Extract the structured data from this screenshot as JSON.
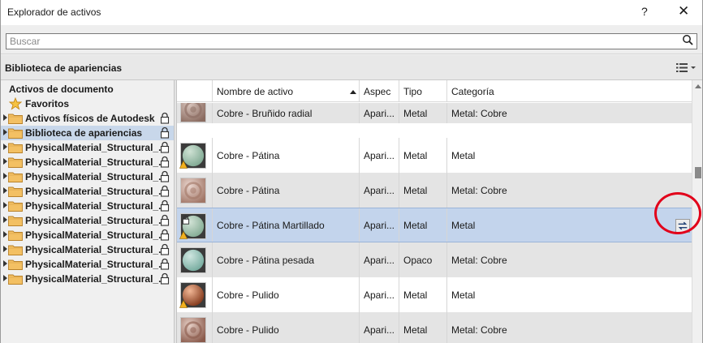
{
  "window": {
    "title": "Explorador de activos",
    "help_label": "?",
    "close_label": "✕"
  },
  "search": {
    "placeholder": "Buscar",
    "value": ""
  },
  "library_bar": {
    "title": "Biblioteca de apariencias"
  },
  "tree": {
    "header": "Activos de documento",
    "items": [
      {
        "label": "Favoritos",
        "icon": "star-icon",
        "locked": false
      },
      {
        "label": "Activos físicos de Autodesk",
        "icon": "folder-icon",
        "locked": true
      },
      {
        "label": "Biblioteca de apariencias",
        "icon": "folder-icon",
        "locked": true,
        "selected": true
      },
      {
        "label": "PhysicalMaterial_Structural_...",
        "icon": "folder-icon",
        "locked": true
      },
      {
        "label": "PhysicalMaterial_Structural_...",
        "icon": "folder-icon",
        "locked": true
      },
      {
        "label": "PhysicalMaterial_Structural_...",
        "icon": "folder-icon",
        "locked": true
      },
      {
        "label": "PhysicalMaterial_Structural_...",
        "icon": "folder-icon",
        "locked": true
      },
      {
        "label": "PhysicalMaterial_Structural_...",
        "icon": "folder-icon",
        "locked": true
      },
      {
        "label": "PhysicalMaterial_Structural_...",
        "icon": "folder-icon",
        "locked": true
      },
      {
        "label": "PhysicalMaterial_Structural_...",
        "icon": "folder-icon",
        "locked": true
      },
      {
        "label": "PhysicalMaterial_Structural_...",
        "icon": "folder-icon",
        "locked": true
      },
      {
        "label": "PhysicalMaterial_Structural_...",
        "icon": "folder-icon",
        "locked": true
      },
      {
        "label": "PhysicalMaterial_Structural_...",
        "icon": "folder-icon",
        "locked": true
      }
    ]
  },
  "columns": {
    "name": "Nombre de activo",
    "aspect": "Aspec",
    "type": "Tipo",
    "category": "Categoría"
  },
  "rows": [
    {
      "name": "Cobre - Bruñido radial",
      "aspect": "Apari...",
      "type": "Metal",
      "category": "Metal: Cobre",
      "thumb": "radial-bronze"
    },
    {
      "name": "Cobre - Pátina",
      "aspect": "Apari...",
      "type": "Metal",
      "category": "Metal",
      "thumb": "patina"
    },
    {
      "name": "Cobre - Pátina",
      "aspect": "Apari...",
      "type": "Metal",
      "category": "Metal: Cobre",
      "thumb": "radial-copper"
    },
    {
      "name": "Cobre - Pátina Martillado",
      "aspect": "Apari...",
      "type": "Metal",
      "category": "Metal",
      "thumb": "patina-hammered",
      "selected": true
    },
    {
      "name": "Cobre - Pátina pesada",
      "aspect": "Apari...",
      "type": "Opaco",
      "category": "Metal: Cobre",
      "thumb": "patina-heavy"
    },
    {
      "name": "Cobre - Pulido",
      "aspect": "Apari...",
      "type": "Metal",
      "category": "Metal",
      "thumb": "polished-sphere"
    },
    {
      "name": "Cobre - Pulido",
      "aspect": "Apari...",
      "type": "Metal",
      "category": "Metal: Cobre",
      "thumb": "polished-ring"
    }
  ],
  "colors": {
    "selection": "#c3d4ec",
    "highlight_circle": "#e2001a",
    "folder": "#f0b84a"
  }
}
